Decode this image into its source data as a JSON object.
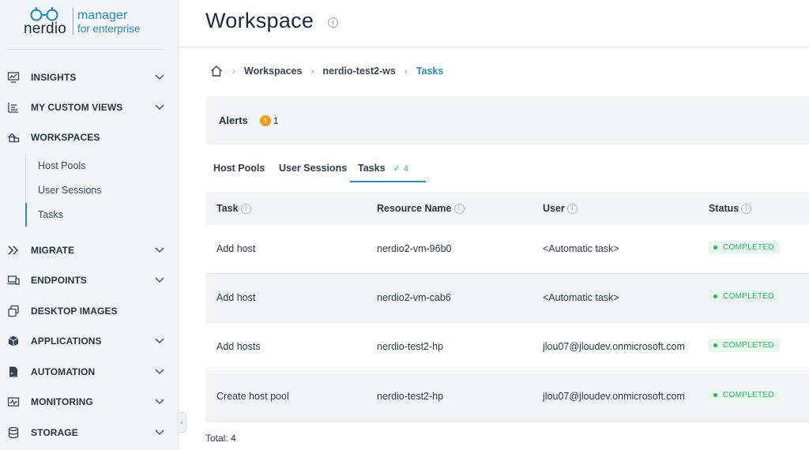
{
  "brand": {
    "wordmark": "nerdio",
    "product_line1": "manager",
    "product_line2": "for enterprise",
    "accent": "#2b8fb0"
  },
  "sidebar": {
    "items": [
      {
        "label": "INSIGHTS",
        "icon": "insights-icon",
        "expandable": true
      },
      {
        "label": "MY CUSTOM VIEWS",
        "icon": "custom-views-icon",
        "expandable": true
      },
      {
        "label": "WORKSPACES",
        "icon": "workspaces-icon",
        "expandable": false
      },
      {
        "label": "MIGRATE",
        "icon": "migrate-icon",
        "expandable": true
      },
      {
        "label": "ENDPOINTS",
        "icon": "endpoints-icon",
        "expandable": true
      },
      {
        "label": "DESKTOP IMAGES",
        "icon": "desktop-images-icon",
        "expandable": false
      },
      {
        "label": "APPLICATIONS",
        "icon": "applications-icon",
        "expandable": true
      },
      {
        "label": "AUTOMATION",
        "icon": "automation-icon",
        "expandable": true
      },
      {
        "label": "MONITORING",
        "icon": "monitoring-icon",
        "expandable": true
      },
      {
        "label": "STORAGE",
        "icon": "storage-icon",
        "expandable": true
      }
    ],
    "workspaces_sub": [
      {
        "label": "Host Pools"
      },
      {
        "label": "User Sessions"
      },
      {
        "label": "Tasks",
        "active": true
      }
    ]
  },
  "header": {
    "title": "Workspace"
  },
  "breadcrumb": {
    "items": [
      "Workspaces",
      "nerdio-test2-ws"
    ],
    "current": "Tasks"
  },
  "alerts": {
    "label": "Alerts",
    "count": "1",
    "badge_color": "#f29b1d"
  },
  "tabs": [
    {
      "label": "Host Pools"
    },
    {
      "label": "User Sessions"
    },
    {
      "label": "Tasks",
      "count": "4",
      "active": true
    }
  ],
  "table": {
    "columns": [
      "Task",
      "Resource Name",
      "User",
      "Status"
    ],
    "rows": [
      {
        "task": "Add host",
        "resource": "nerdio2-vm-96b0",
        "user": "<Automatic task>",
        "status": "COMPLETED"
      },
      {
        "task": "Add host",
        "resource": "nerdio2-vm-cab6",
        "user": "<Automatic task>",
        "status": "COMPLETED"
      },
      {
        "task": "Add hosts",
        "resource": "nerdio-test2-hp",
        "user": "jlou07@jloudev.onmicrosoft.com",
        "status": "COMPLETED"
      },
      {
        "task": "Create host pool",
        "resource": "nerdio-test2-hp",
        "user": "jlou07@jloudev.onmicrosoft.com",
        "status": "COMPLETED"
      }
    ],
    "status_color": "#2fb36a"
  },
  "footer": {
    "total": "Total: 4"
  }
}
